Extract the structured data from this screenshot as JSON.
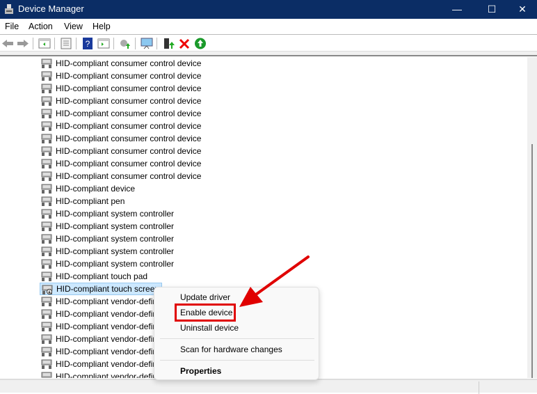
{
  "window": {
    "title": "Device Manager",
    "minimize": "—",
    "maximize": "☐",
    "close": "✕"
  },
  "menu": [
    "File",
    "Action",
    "View",
    "Help"
  ],
  "toolbar": [
    "back-icon",
    "forward-icon",
    "show-hide-console-tree-icon",
    "properties-icon",
    "help-icon",
    "action-pane-icon",
    "update-driver-icon",
    "scan-hardware-icon",
    "enable-device-icon",
    "uninstall-icon",
    "enable-green-icon"
  ],
  "devices": [
    "HID-compliant consumer control device",
    "HID-compliant consumer control device",
    "HID-compliant consumer control device",
    "HID-compliant consumer control device",
    "HID-compliant consumer control device",
    "HID-compliant consumer control device",
    "HID-compliant consumer control device",
    "HID-compliant consumer control device",
    "HID-compliant consumer control device",
    "HID-compliant consumer control device",
    "HID-compliant device",
    "HID-compliant pen",
    "HID-compliant system controller",
    "HID-compliant system controller",
    "HID-compliant system controller",
    "HID-compliant system controller",
    "HID-compliant system controller",
    "HID-compliant touch pad",
    "HID-compliant touch screen",
    "HID-compliant vendor-defined device",
    "HID-compliant vendor-defined device",
    "HID-compliant vendor-defined device",
    "HID-compliant vendor-defined device",
    "HID-compliant vendor-defined device",
    "HID-compliant vendor-defined device",
    "HID-compliant vendor-defined device"
  ],
  "selected_index": 18,
  "context_menu": {
    "update": "Update driver",
    "enable": "Enable device",
    "uninstall": "Uninstall device",
    "scan": "Scan for hardware changes",
    "properties": "Properties"
  },
  "colors": {
    "titlebar": "#0b2d65",
    "highlight": "#e00000",
    "selection": "#cce8ff"
  }
}
